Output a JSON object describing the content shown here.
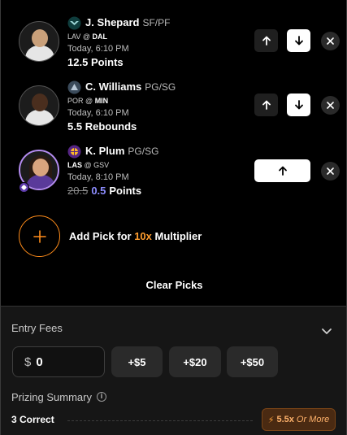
{
  "picks": [
    {
      "player": "J. Shepard",
      "position": "SF/PF",
      "team": "LAV",
      "opponent": "DAL",
      "time": "Today, 6:10 PM",
      "line": "12.5",
      "stat": "Points",
      "selected": "down"
    },
    {
      "player": "C. Williams",
      "position": "PG/SG",
      "team": "POR",
      "opponent": "MIN",
      "time": "Today, 6:10 PM",
      "line": "5.5",
      "stat": "Rebounds",
      "selected": "down"
    },
    {
      "player": "K. Plum",
      "position": "PG/SG",
      "team": "LAS",
      "opponent": "GSV",
      "time": "Today, 8:10 PM",
      "old_line": "20.5",
      "line": "0.5",
      "stat": "Points",
      "selected": "up-only"
    }
  ],
  "matchup_sep": "@",
  "add_pick": {
    "prefix": "Add Pick for",
    "multiplier": "10x",
    "suffix": "Multiplier"
  },
  "clear_label": "Clear Picks",
  "entry_fees": {
    "title": "Entry Fees",
    "currency": "$",
    "value": "0",
    "chips": [
      "+$5",
      "+$20",
      "+$50"
    ]
  },
  "prizing": {
    "title": "Prizing Summary",
    "correct_label": "3 Correct",
    "multiplier": "5.5x",
    "more_label": "Or More"
  },
  "colors": {
    "accent_orange": "#ff8c1a",
    "line_purple": "#8d8dff",
    "panel_bg": "#000000",
    "bottom_bg": "#161616"
  }
}
